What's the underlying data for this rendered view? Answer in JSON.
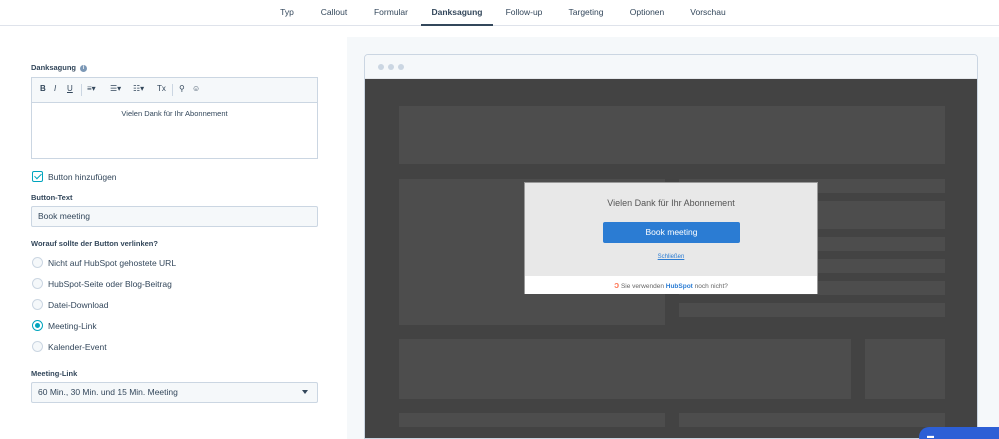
{
  "tabs": [
    {
      "label": "Typ"
    },
    {
      "label": "Callout"
    },
    {
      "label": "Formular"
    },
    {
      "label": "Danksagung"
    },
    {
      "label": "Follow-up"
    },
    {
      "label": "Targeting"
    },
    {
      "label": "Optionen"
    },
    {
      "label": "Vorschau"
    }
  ],
  "form": {
    "thanks_label": "Danksagung",
    "info_icon": "info-icon",
    "editor_text": "Vielen Dank für Ihr Abonnement",
    "add_button_label": "Button hinzufügen",
    "button_text_label": "Button-Text",
    "button_text_value": "Book meeting",
    "link_question": "Worauf sollte der Button verlinken?",
    "link_options": [
      {
        "label": "Nicht auf HubSpot gehostete URL"
      },
      {
        "label": "HubSpot-Seite oder Blog-Beitrag"
      },
      {
        "label": "Datei-Download"
      },
      {
        "label": "Meeting-Link"
      },
      {
        "label": "Kalender-Event"
      }
    ],
    "selected_option": "Meeting-Link",
    "meeting_link_label": "Meeting-Link",
    "meeting_link_value": "60 Min., 30 Min. und 15 Min. Meeting"
  },
  "toolbar": {
    "bold": "B",
    "italic": "I",
    "underline": "U",
    "clear": "Tx"
  },
  "preview": {
    "modal_title": "Vielen Dank für Ihr Abonnement",
    "modal_button": "Book meeting",
    "modal_close": "Schließen",
    "footer_prefix": "Sie verwenden",
    "footer_brand": "HubSpot",
    "footer_suffix": "noch nicht?"
  },
  "colors": {
    "accent": "#00a4bd",
    "modal_button": "#2b7cd3",
    "hubspot_orange": "#ff7a59"
  }
}
